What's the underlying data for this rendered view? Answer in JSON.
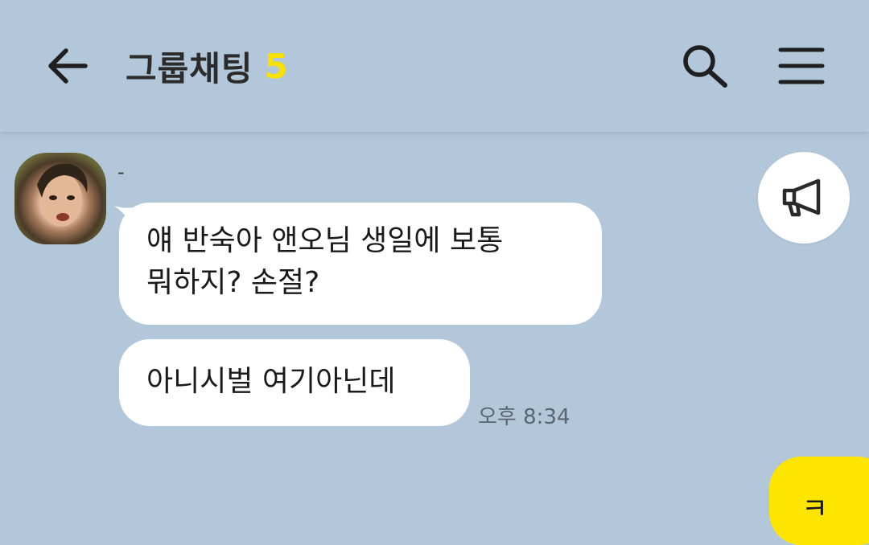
{
  "header": {
    "title": "그룹채팅",
    "member_count": "5",
    "accent_color": "#fae100"
  },
  "icons": {
    "back": "arrow-left",
    "search": "magnifier",
    "menu": "hamburger",
    "announce": "megaphone"
  },
  "messages": [
    {
      "sender": "-",
      "lines": [
        "얘 반숙아 앤오님 생일에 보통",
        "뭐하지? 손절?"
      ]
    },
    {
      "text": "아니시벌 여기아닌데",
      "time": "오후 8:34"
    }
  ],
  "my_message": {
    "text": "ㅋ",
    "bubble_color": "#fee500"
  }
}
